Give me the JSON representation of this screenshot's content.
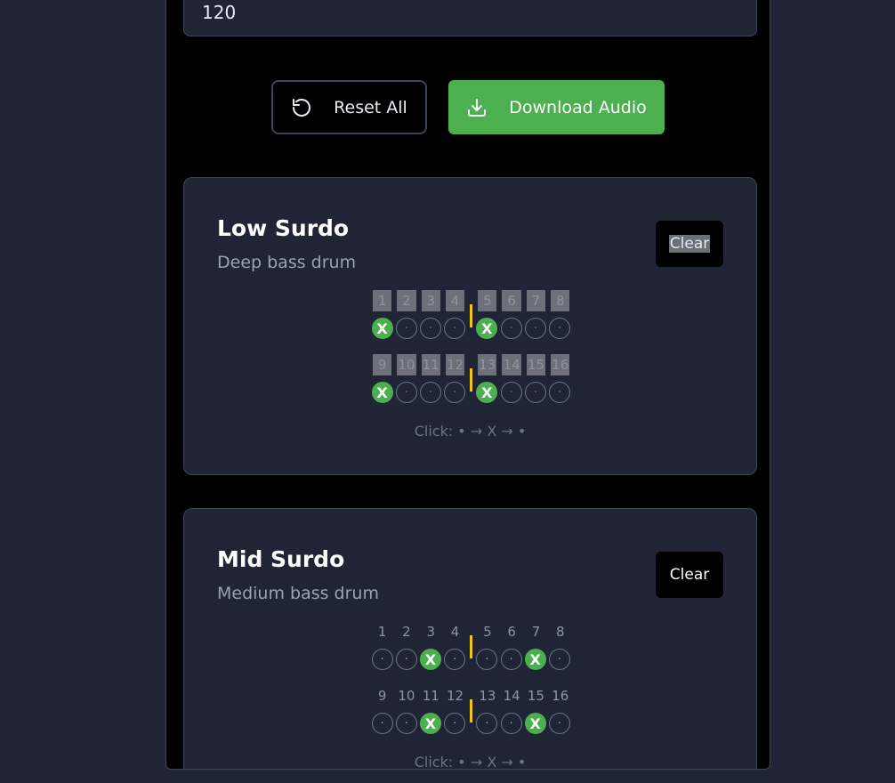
{
  "bpm": {
    "value": "120"
  },
  "actions": {
    "reset_label": "Reset All",
    "download_label": "Download Audio"
  },
  "colors": {
    "accent": "#4caf50",
    "divider": "#f0c419",
    "card_bg": "#1f2535"
  },
  "tracks": [
    {
      "name": "Low Surdo",
      "description": "Deep bass drum",
      "clear_label": "Clear",
      "rows": [
        {
          "numbers": [
            "1",
            "2",
            "3",
            "4",
            "5",
            "6",
            "7",
            "8"
          ],
          "beats": [
            "X",
            "·",
            "·",
            "·",
            "X",
            "·",
            "·",
            "·"
          ]
        },
        {
          "numbers": [
            "9",
            "10",
            "11",
            "12",
            "13",
            "14",
            "15",
            "16"
          ],
          "beats": [
            "X",
            "·",
            "·",
            "·",
            "X",
            "·",
            "·",
            "·"
          ]
        }
      ],
      "hint": "Click: • → X → •"
    },
    {
      "name": "Mid Surdo",
      "description": "Medium bass drum",
      "clear_label": "Clear",
      "rows": [
        {
          "numbers": [
            "1",
            "2",
            "3",
            "4",
            "5",
            "6",
            "7",
            "8"
          ],
          "beats": [
            "·",
            "·",
            "X",
            "·",
            "·",
            "·",
            "X",
            "·"
          ]
        },
        {
          "numbers": [
            "9",
            "10",
            "11",
            "12",
            "13",
            "14",
            "15",
            "16"
          ],
          "beats": [
            "·",
            "·",
            "X",
            "·",
            "·",
            "·",
            "X",
            "·"
          ]
        }
      ],
      "hint": "Click: • → X → •"
    }
  ]
}
